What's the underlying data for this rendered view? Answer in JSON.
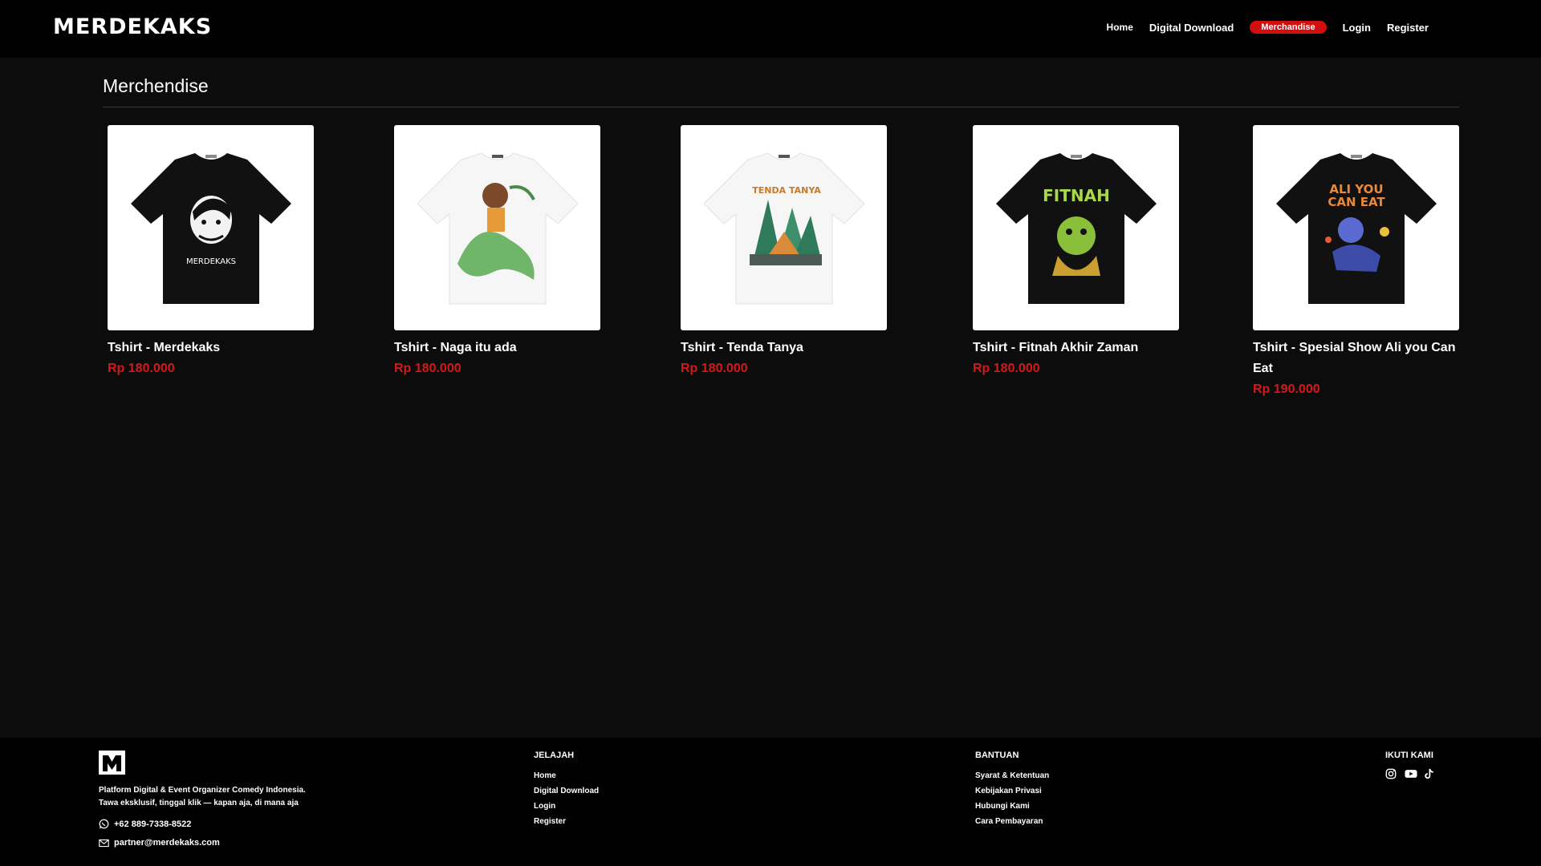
{
  "header": {
    "logo_text": "MERDEKAKS",
    "nav": [
      {
        "label": "Home"
      },
      {
        "label": "Digital Download"
      },
      {
        "label": "Merchandise",
        "active": true
      },
      {
        "label": "Login"
      },
      {
        "label": "Register"
      }
    ]
  },
  "page": {
    "title": "Merchendise"
  },
  "products": [
    {
      "name": "Tshirt - Merdekaks",
      "price": "Rp 180.000",
      "shirt_color": "black"
    },
    {
      "name": "Tshirt - Naga itu ada",
      "price": "Rp 180.000",
      "shirt_color": "white"
    },
    {
      "name": "Tshirt - Tenda Tanya",
      "price": "Rp 180.000",
      "shirt_color": "white"
    },
    {
      "name": "Tshirt - Fitnah Akhir Zaman",
      "price": "Rp 180.000",
      "shirt_color": "black"
    },
    {
      "name": "Tshirt - Spesial Show Ali you Can Eat",
      "price": "Rp 190.000",
      "shirt_color": "black"
    }
  ],
  "footer": {
    "desc_line1": "Platform Digital & Event Organizer Comedy Indonesia.",
    "desc_line2": "Tawa eksklusif, tinggal klik — kapan aja, di mana aja",
    "phone": "+62 889-7338-8522",
    "email": "partner@merdekaks.com",
    "jelajah": {
      "title": "JELAJAH",
      "links": [
        "Home",
        "Digital Download",
        "Login",
        "Register"
      ]
    },
    "bantuan": {
      "title": "BANTUAN",
      "links": [
        "Syarat & Ketentuan",
        "Kebijakan Privasi",
        "Hubungi Kami",
        "Cara Pembayaran"
      ]
    },
    "ikuti": {
      "title": "IKUTI KAMI",
      "icons": [
        "instagram-icon",
        "youtube-icon",
        "tiktok-icon"
      ]
    }
  },
  "colors": {
    "accent": "#d10f0f",
    "price": "#d11a1a",
    "background": "#0c0c0c",
    "header_bg": "#000000"
  }
}
